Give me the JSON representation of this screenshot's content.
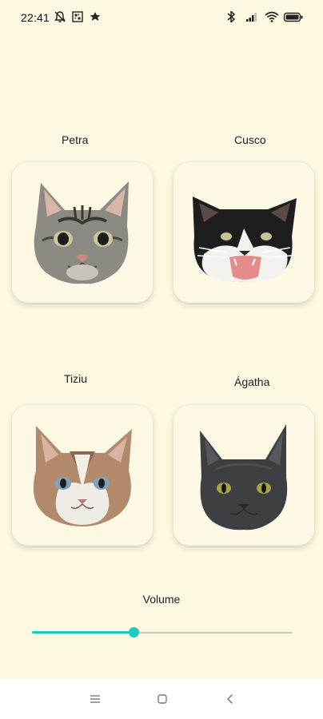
{
  "status_bar": {
    "time": "22:41",
    "left_icons": [
      "alarm-off-icon",
      "qr-notification-icon",
      "app-notification-icon"
    ],
    "right_icons": [
      "bluetooth-icon",
      "signal-icon",
      "wifi-icon",
      "battery-icon"
    ]
  },
  "cats": [
    {
      "name": "Petra",
      "icon": "tabby-cat-face-icon"
    },
    {
      "name": "Cusco",
      "icon": "black-white-cat-face-icon"
    },
    {
      "name": "Tiziu",
      "icon": "orange-white-cat-face-icon"
    },
    {
      "name": "Ágatha",
      "icon": "gray-cat-face-icon"
    }
  ],
  "volume": {
    "label": "Volume",
    "value": 0.39,
    "accent_color": "#1fc8c0"
  },
  "nav": {
    "icons": [
      "menu-icon",
      "home-icon",
      "back-icon"
    ]
  },
  "colors": {
    "background": "#fdf8e1",
    "accent": "#1fc8c0"
  }
}
